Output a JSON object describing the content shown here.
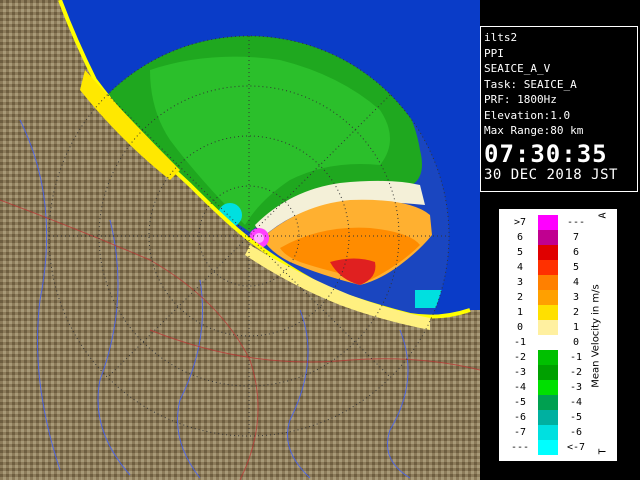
{
  "info": {
    "site": "ilts2",
    "product": "PPI",
    "task_name": "SEAICE_A_V",
    "task": "Task: SEAICE_A",
    "prf": "PRF: 1800Hz",
    "elevation": "Elevation:1.0",
    "max_range": "Max Range:80 km",
    "time": "07:30:35",
    "date": "30 DEC 2018 JST"
  },
  "legend": {
    "title": "Mean Velocity in m/s",
    "corner_top": "A",
    "corner_bottom": "T",
    "rows": [
      {
        "left": ">7",
        "right": "---",
        "color": "#ff00ff"
      },
      {
        "left": "6",
        "right": "7",
        "color": "#c00090"
      },
      {
        "left": "5",
        "right": "6",
        "color": "#e00000"
      },
      {
        "left": "4",
        "right": "5",
        "color": "#ff3000"
      },
      {
        "left": "3",
        "right": "4",
        "color": "#ff8000"
      },
      {
        "left": "2",
        "right": "3",
        "color": "#ffa000"
      },
      {
        "left": "1",
        "right": "2",
        "color": "#ffe000"
      },
      {
        "left": "0",
        "right": "1",
        "color": "#fff0a0"
      },
      {
        "left": "-1",
        "right": "0",
        "color": "#ffffff"
      },
      {
        "left": "-2",
        "right": "-1",
        "color": "#00c000"
      },
      {
        "left": "-3",
        "right": "-2",
        "color": "#00a000"
      },
      {
        "left": "-4",
        "right": "-3",
        "color": "#00e000"
      },
      {
        "left": "-5",
        "right": "-4",
        "color": "#00a050"
      },
      {
        "left": "-6",
        "right": "-5",
        "color": "#00b0a0"
      },
      {
        "left": "-7",
        "right": "-6",
        "color": "#00e0e0"
      },
      {
        "left": "---",
        "right": "<-7",
        "color": "#00ffff"
      }
    ]
  },
  "colors": {
    "ocean": "#0a3cc8",
    "radar_disc": "#1a46c0",
    "land": "#8a7a5c",
    "coast": "#ffff00"
  }
}
